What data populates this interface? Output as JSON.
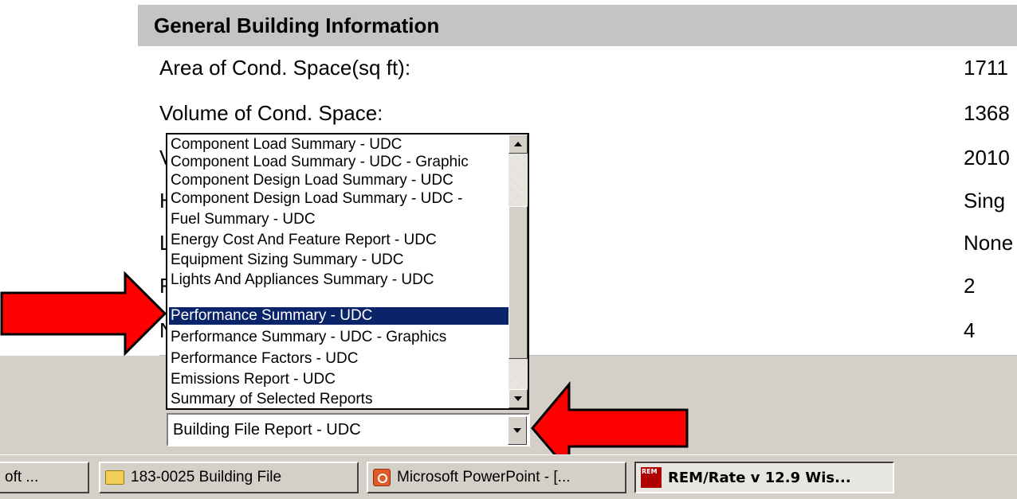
{
  "section": {
    "title": "General Building Information"
  },
  "info_rows": [
    {
      "label": "Area of Cond. Space(sq ft):",
      "value": "1711"
    },
    {
      "label": "Volume of Cond. Space:",
      "value": "1368"
    },
    {
      "label": "V",
      "value": "2010"
    },
    {
      "label": "H",
      "value": "Sing"
    },
    {
      "label": "L",
      "value": "None"
    },
    {
      "label": "F",
      "value": "2"
    },
    {
      "label": "N",
      "value": "4"
    }
  ],
  "report_list": {
    "items": [
      "Component Load Summary - UDC",
      "Component Load Summary - UDC - Graphic",
      "Component Design Load Summary - UDC",
      "Component Design Load Summary - UDC -",
      "Fuel Summary - UDC",
      "Energy Cost And Feature Report - UDC",
      "Equipment Sizing Summary - UDC",
      "Lights And Appliances Summary - UDC",
      "Performance Summary - UDC",
      "Performance Summary - UDC - Graphics",
      "Performance Factors - UDC",
      "Emissions Report - UDC",
      "Summary of Selected Reports"
    ],
    "selected_index": 8
  },
  "report_combo": {
    "value": "Building File Report - UDC"
  },
  "taskbar": {
    "buttons": [
      {
        "label": "oft ...",
        "icon": "none"
      },
      {
        "label": "183-0025 Building File",
        "icon": "folder-icon"
      },
      {
        "label": "Microsoft PowerPoint - [...",
        "icon": "powerpoint-icon"
      },
      {
        "label": "REM/Rate v 12.9  Wis...",
        "icon": "rem-rate-icon",
        "icon_text": "REM"
      }
    ]
  },
  "colors": {
    "arrow": "#ff0000",
    "selection": "#0a246a",
    "header_band": "#c4c4c4"
  }
}
